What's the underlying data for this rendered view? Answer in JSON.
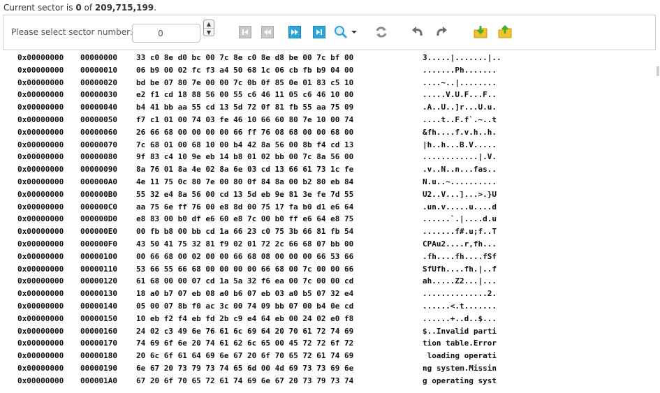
{
  "status": {
    "prefix": "Current sector is ",
    "current": "0",
    "middle": " of ",
    "total": "209,715,199",
    "suffix": "."
  },
  "toolbar": {
    "label": "Please select sector number:",
    "sector_value": "0",
    "icons": [
      "first-sector-icon",
      "prev-sector-icon",
      "next-sector-icon",
      "last-sector-icon",
      "search-icon",
      "chevron-down-icon",
      "refresh-icon",
      "undo-icon",
      "redo-icon",
      "folder-import-icon",
      "folder-export-icon"
    ]
  },
  "colors": {
    "nav_blue": "#2aa6d8",
    "nav_gray": "#c9c9c9",
    "folder_yellow": "#f2c12e",
    "arrow_green": "#3fae2f",
    "undo_gray": "#6b6b6b"
  },
  "rows": [
    {
      "a1": "0x00000000",
      "a2": "00000000",
      "hex": "33 c0 8e d0 bc 00 7c 8e c0 8e d8 be 00 7c bf 00",
      "ascii": "3.....|.......|.."
    },
    {
      "a1": "0x00000000",
      "a2": "00000010",
      "hex": "06 b9 00 02 fc f3 a4 50 68 1c 06 cb fb b9 04 00",
      "ascii": ".......Ph......."
    },
    {
      "a1": "0x00000000",
      "a2": "00000020",
      "hex": "bd be 07 80 7e 00 00 7c 0b 0f 85 0e 01 83 c5 10",
      "ascii": "....~..|........"
    },
    {
      "a1": "0x00000000",
      "a2": "00000030",
      "hex": "e2 f1 cd 18 88 56 00 55 c6 46 11 05 c6 46 10 00",
      "ascii": ".....V.U.F...F.."
    },
    {
      "a1": "0x00000000",
      "a2": "00000040",
      "hex": "b4 41 bb aa 55 cd 13 5d 72 0f 81 fb 55 aa 75 09",
      "ascii": ".A..U..]r...U.u."
    },
    {
      "a1": "0x00000000",
      "a2": "00000050",
      "hex": "f7 c1 01 00 74 03 fe 46 10 66 60 80 7e 10 00 74",
      "ascii": "....t..F.f`.~..t"
    },
    {
      "a1": "0x00000000",
      "a2": "00000060",
      "hex": "26 66 68 00 00 00 00 66 ff 76 08 68 00 00 68 00",
      "ascii": "&fh....f.v.h..h."
    },
    {
      "a1": "0x00000000",
      "a2": "00000070",
      "hex": "7c 68 01 00 68 10 00 b4 42 8a 56 00 8b f4 cd 13",
      "ascii": "|h..h...B.V....."
    },
    {
      "a1": "0x00000000",
      "a2": "00000080",
      "hex": "9f 83 c4 10 9e eb 14 b8 01 02 bb 00 7c 8a 56 00",
      "ascii": "............|.V."
    },
    {
      "a1": "0x00000000",
      "a2": "00000090",
      "hex": "8a 76 01 8a 4e 02 8a 6e 03 cd 13 66 61 73 1c fe",
      "ascii": ".v..N..n...fas.."
    },
    {
      "a1": "0x00000000",
      "a2": "000000A0",
      "hex": "4e 11 75 0c 80 7e 00 80 0f 84 8a 00 b2 80 eb 84",
      "ascii": "N.u..~.........."
    },
    {
      "a1": "0x00000000",
      "a2": "000000B0",
      "hex": "55 32 e4 8a 56 00 cd 13 5d eb 9e 81 3e fe 7d 55",
      "ascii": "U2..V...]...>.}U"
    },
    {
      "a1": "0x00000000",
      "a2": "000000C0",
      "hex": "aa 75 6e ff 76 00 e8 8d 00 75 17 fa b0 d1 e6 64",
      "ascii": ".un.v.....u....d"
    },
    {
      "a1": "0x00000000",
      "a2": "000000D0",
      "hex": "e8 83 00 b0 df e6 60 e8 7c 00 b0 ff e6 64 e8 75",
      "ascii": "......`.|....d.u"
    },
    {
      "a1": "0x00000000",
      "a2": "000000E0",
      "hex": "00 fb b8 00 bb cd 1a 66 23 c0 75 3b 66 81 fb 54",
      "ascii": ".......f#.u;f..T"
    },
    {
      "a1": "0x00000000",
      "a2": "000000F0",
      "hex": "43 50 41 75 32 81 f9 02 01 72 2c 66 68 07 bb 00",
      "ascii": "CPAu2....r,fh..."
    },
    {
      "a1": "0x00000000",
      "a2": "00000100",
      "hex": "00 66 68 00 02 00 00 66 68 08 00 00 00 66 53 66",
      "ascii": ".fh....fh....fSf"
    },
    {
      "a1": "0x00000000",
      "a2": "00000110",
      "hex": "53 66 55 66 68 00 00 00 00 66 68 00 7c 00 00 66",
      "ascii": "SfUfh....fh.|..f"
    },
    {
      "a1": "0x00000000",
      "a2": "00000120",
      "hex": "61 68 00 00 07 cd 1a 5a 32 f6 ea 00 7c 00 00 cd",
      "ascii": "ah.....Z2...|..."
    },
    {
      "a1": "0x00000000",
      "a2": "00000130",
      "hex": "18 a0 b7 07 eb 08 a0 b6 07 eb 03 a0 b5 07 32 e4",
      "ascii": "..............2."
    },
    {
      "a1": "0x00000000",
      "a2": "00000140",
      "hex": "05 00 07 8b f0 ac 3c 00 74 09 bb 07 00 b4 0e cd",
      "ascii": "......<.t......."
    },
    {
      "a1": "0x00000000",
      "a2": "00000150",
      "hex": "10 eb f2 f4 eb fd 2b c9 e4 64 eb 00 24 02 e0 f8",
      "ascii": "......+..d..$..."
    },
    {
      "a1": "0x00000000",
      "a2": "00000160",
      "hex": "24 02 c3 49 6e 76 61 6c 69 64 20 70 61 72 74 69",
      "ascii": "$..Invalid parti"
    },
    {
      "a1": "0x00000000",
      "a2": "00000170",
      "hex": "74 69 6f 6e 20 74 61 62 6c 65 00 45 72 72 6f 72",
      "ascii": "tion table.Error"
    },
    {
      "a1": "0x00000000",
      "a2": "00000180",
      "hex": "20 6c 6f 61 64 69 6e 67 20 6f 70 65 72 61 74 69",
      "ascii": " loading operati"
    },
    {
      "a1": "0x00000000",
      "a2": "00000190",
      "hex": "6e 67 20 73 79 73 74 65 6d 00 4d 69 73 73 69 6e",
      "ascii": "ng system.Missin"
    },
    {
      "a1": "0x00000000",
      "a2": "000001A0",
      "hex": "67 20 6f 70 65 72 61 74 69 6e 67 20 73 79 73 74",
      "ascii": "g operating syst"
    }
  ]
}
